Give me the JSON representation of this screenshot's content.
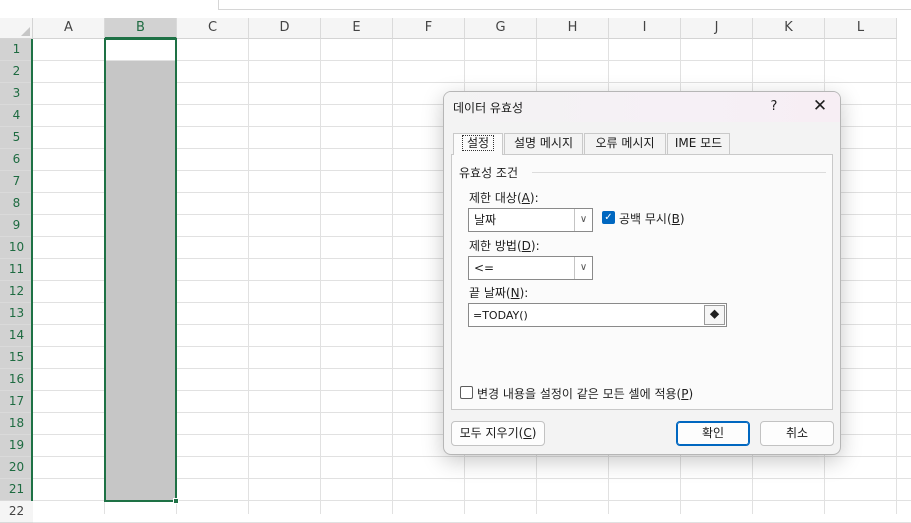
{
  "sheet": {
    "columns": [
      "A",
      "B",
      "C",
      "D",
      "E",
      "F",
      "G",
      "H",
      "I",
      "J",
      "K",
      "L"
    ],
    "rows": [
      "1",
      "2",
      "3",
      "4",
      "5",
      "6",
      "7",
      "8",
      "9",
      "10",
      "11",
      "12",
      "13",
      "14",
      "15",
      "16",
      "17",
      "18",
      "19",
      "20",
      "21",
      "22"
    ],
    "selected_column": "B",
    "selection_color": "#1e7145"
  },
  "dialog": {
    "title": "데이터 유효성",
    "help_glyph": "?",
    "close_glyph": "✕",
    "tabs": [
      {
        "label": "설정",
        "active": true
      },
      {
        "label": "설명 메시지",
        "active": false
      },
      {
        "label": "오류 메시지",
        "active": false
      },
      {
        "label": "IME 모드",
        "active": false
      }
    ],
    "settings": {
      "group_label": "유효성 조건",
      "allow": {
        "label_prefix": "제한 대상(",
        "label_key": "A",
        "label_suffix": "):",
        "value": "날짜"
      },
      "ignore_blank": {
        "label_prefix": "공백 무시(",
        "label_key": "B",
        "label_suffix": ")",
        "checked": true
      },
      "data": {
        "label_prefix": "제한 방법(",
        "label_key": "D",
        "label_suffix": "):",
        "value": "<="
      },
      "end_date": {
        "label_prefix": "끝 날짜(",
        "label_key": "N",
        "label_suffix": "):",
        "value": "=TODAY()"
      },
      "apply_all": {
        "label_prefix": "변경 내용을 설정이 같은 모든 셀에 적용(",
        "label_key": "P",
        "label_suffix": ")",
        "checked": false
      }
    },
    "buttons": {
      "clear_all": {
        "label_prefix": "모두 지우기(",
        "label_key": "C",
        "label_suffix": ")"
      },
      "ok": "확인",
      "cancel": "취소"
    },
    "accent_color": "#0067c0"
  }
}
